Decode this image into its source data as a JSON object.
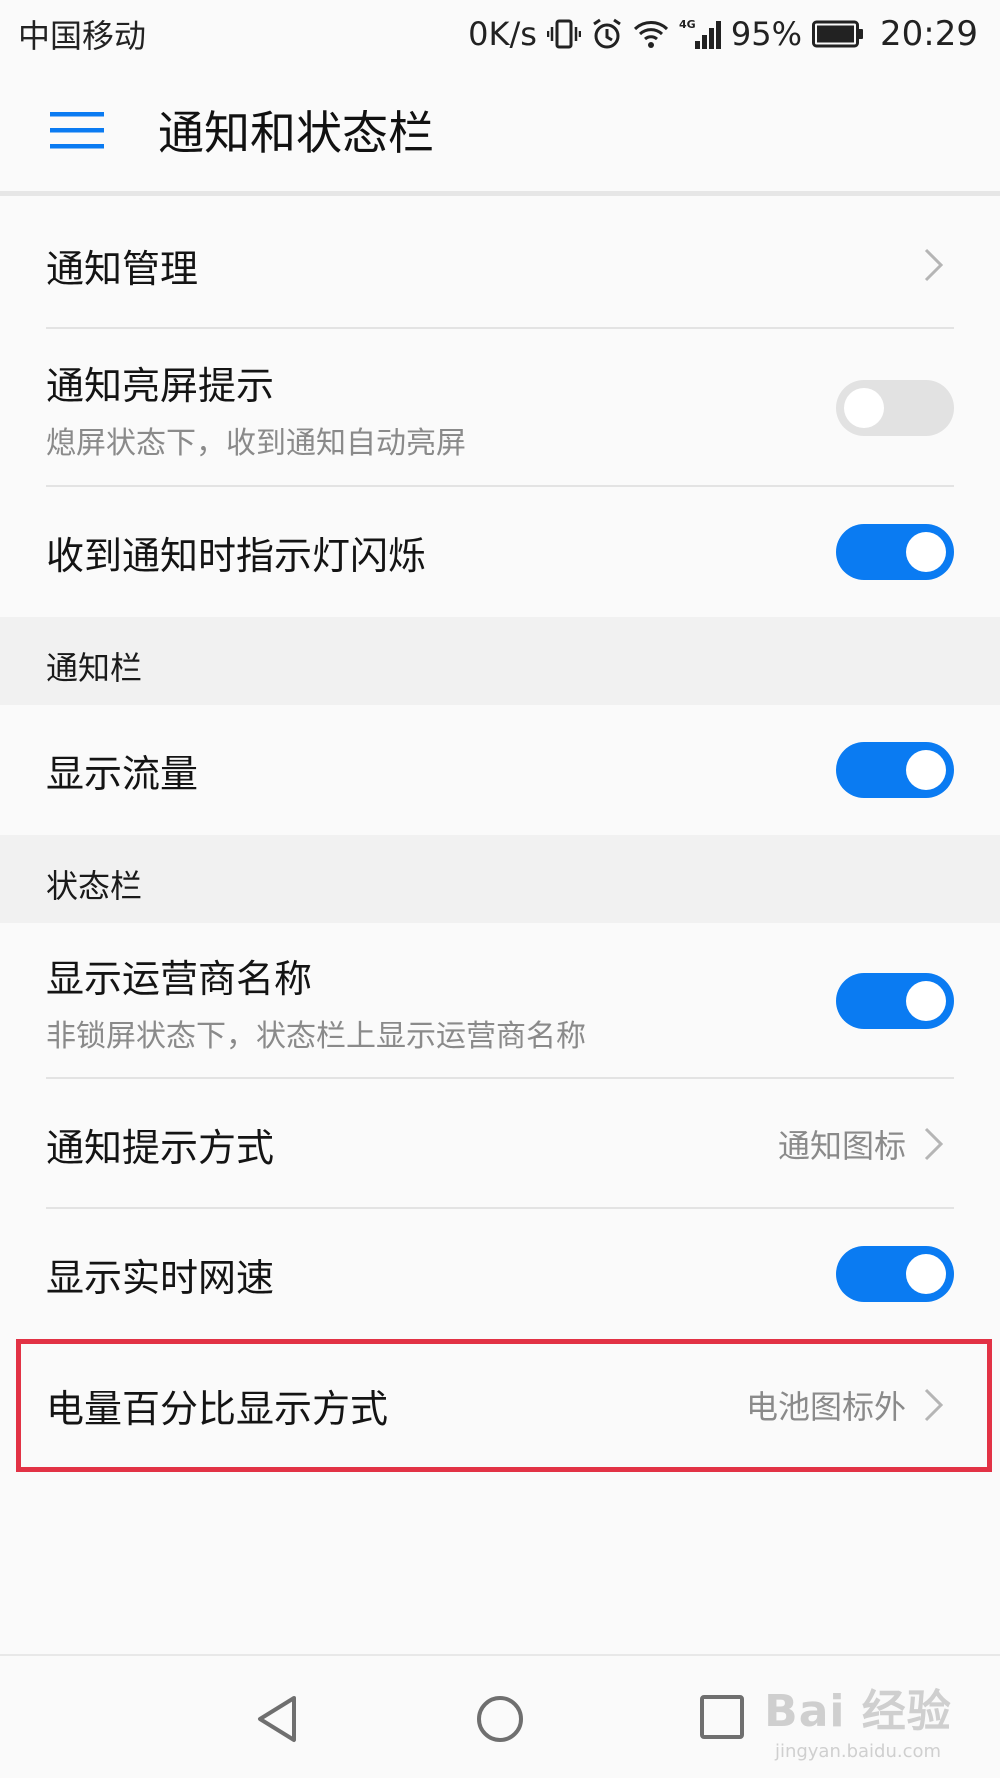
{
  "status_bar": {
    "carrier": "中国移动",
    "speed": "0K/s",
    "network": "4G",
    "battery": "95%",
    "time": "20:29"
  },
  "app_bar": {
    "title": "通知和状态栏"
  },
  "settings": {
    "notification_management": {
      "title": "通知管理"
    },
    "wake_on_notification": {
      "title": "通知亮屏提示",
      "subtitle": "熄屏状态下，收到通知自动亮屏",
      "enabled": false
    },
    "led_blink": {
      "title": "收到通知时指示灯闪烁",
      "enabled": true
    },
    "notification_bar_header": "通知栏",
    "show_data_usage": {
      "title": "显示流量",
      "enabled": true
    },
    "status_bar_header": "状态栏",
    "show_carrier_name": {
      "title": "显示运营商名称",
      "subtitle": "非锁屏状态下，状态栏上显示运营商名称",
      "enabled": true
    },
    "notification_style": {
      "title": "通知提示方式",
      "value": "通知图标"
    },
    "show_network_speed": {
      "title": "显示实时网速",
      "enabled": true
    },
    "battery_percentage": {
      "title": "电量百分比显示方式",
      "value": "电池图标外"
    }
  },
  "colors": {
    "accent": "#0a7bf2",
    "highlight_border": "#e23245"
  },
  "watermark": {
    "logo": "Bai 经验",
    "url": "jingyan.baidu.com"
  }
}
